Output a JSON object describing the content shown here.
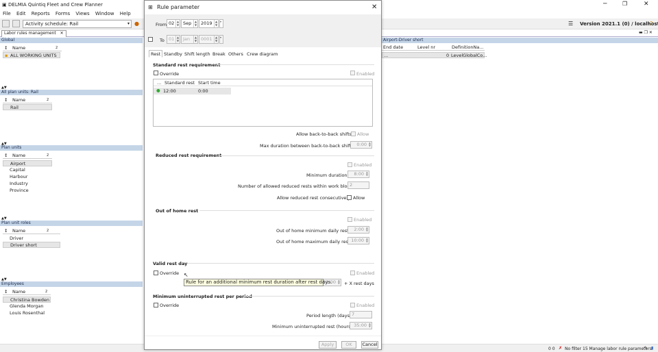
{
  "app": {
    "title": "DELMIA Quintiq Fleet and Crew Planner",
    "version": "Version 2021.1 (0) / localhost"
  },
  "menu": [
    "File",
    "Edit",
    "Reports",
    "Forms",
    "Views",
    "Window",
    "Help"
  ],
  "toolbar": {
    "schedule": "Activity schedule: Rail"
  },
  "doc_tab": "Labor rules management",
  "left": {
    "global": {
      "header": "Global",
      "col": "Name",
      "rows": [
        "ALL WORKING UNITS"
      ]
    },
    "all_plan_units": {
      "header": "All plan units: Rail",
      "col": "Name",
      "rows": [
        "Rail"
      ]
    },
    "plan_units": {
      "header": "Plan units",
      "col": "Name",
      "rows": [
        "Airport",
        "Capital",
        "Harbour",
        "Industry",
        "Province"
      ]
    },
    "plan_unit_roles": {
      "header": "Plan unit roles",
      "col": "Name",
      "rows": [
        "Driver",
        "Driver short"
      ]
    },
    "employees": {
      "header": "Employees",
      "col": "Name",
      "rows": [
        "Christina Bowden",
        "Glenda Morgan",
        "Louis Rosenthal"
      ]
    }
  },
  "right": {
    "header": "Airport-Driver short",
    "columns": [
      "End date",
      "Level nr",
      "DefinitionNa..."
    ],
    "row": [
      "...",
      "0",
      "LevelGlobalCo..."
    ]
  },
  "dialog": {
    "title": "Rule parameter",
    "from_label": "From",
    "from_day": "02",
    "from_month": "Sep",
    "from_year": "2019",
    "to_label": "To",
    "to_day": "01",
    "to_month": "Jan",
    "to_year": "0001",
    "tabs": [
      "Rest",
      "Standby",
      "Shift length",
      "Break",
      "Others",
      "Crew diagram"
    ],
    "standard": {
      "title": "Standard rest requirement",
      "override": "Override",
      "enabled": "Enabled",
      "table_cols": [
        "...",
        "Standard rest",
        "Start time"
      ],
      "table_row": [
        "12:00",
        "0:00"
      ],
      "back_to_back": "Allow back-to-back shifts",
      "allow": "Allow",
      "max_duration": "Max duration between back-to-back shifts",
      "max_duration_val": "0:00"
    },
    "reduced": {
      "title": "Reduced rest requirement",
      "enabled": "Enabled",
      "min_duration": "Minimum duration",
      "min_duration_val": "8:00",
      "num_allowed": "Number of allowed reduced rests within work block",
      "num_allowed_val": "2",
      "consecutive": "Allow reduced rest consecutively",
      "allow": "Allow"
    },
    "out_of_home": {
      "title": "Out of home rest",
      "enabled": "Enabled",
      "min": "Out of home minimum daily rest",
      "min_val": "2:00",
      "max": "Out of home maximum daily rest",
      "max_val": "10:00"
    },
    "valid_rest": {
      "title": "Valid rest day",
      "override": "Override",
      "enabled": "Enabled",
      "hours_val": "11:00",
      "suffix": "+ X rest days"
    },
    "min_uninterrupted": {
      "title": "Minimum uninterrupted rest per period",
      "override": "Override",
      "enabled": "Enabled",
      "period": "Period length (days)",
      "period_val": "7",
      "min": "Minimum uninterrupted rest (hours)",
      "min_val": "35:00"
    },
    "buttons": {
      "apply": "Apply",
      "ok": "OK",
      "cancel": "Cancel"
    }
  },
  "tooltip": "Rule for an additional minimum rest duration after rest days.",
  "status": {
    "zeros": "0 0",
    "filter": "No filter",
    "task": "15 Manage labor rule parameters"
  }
}
